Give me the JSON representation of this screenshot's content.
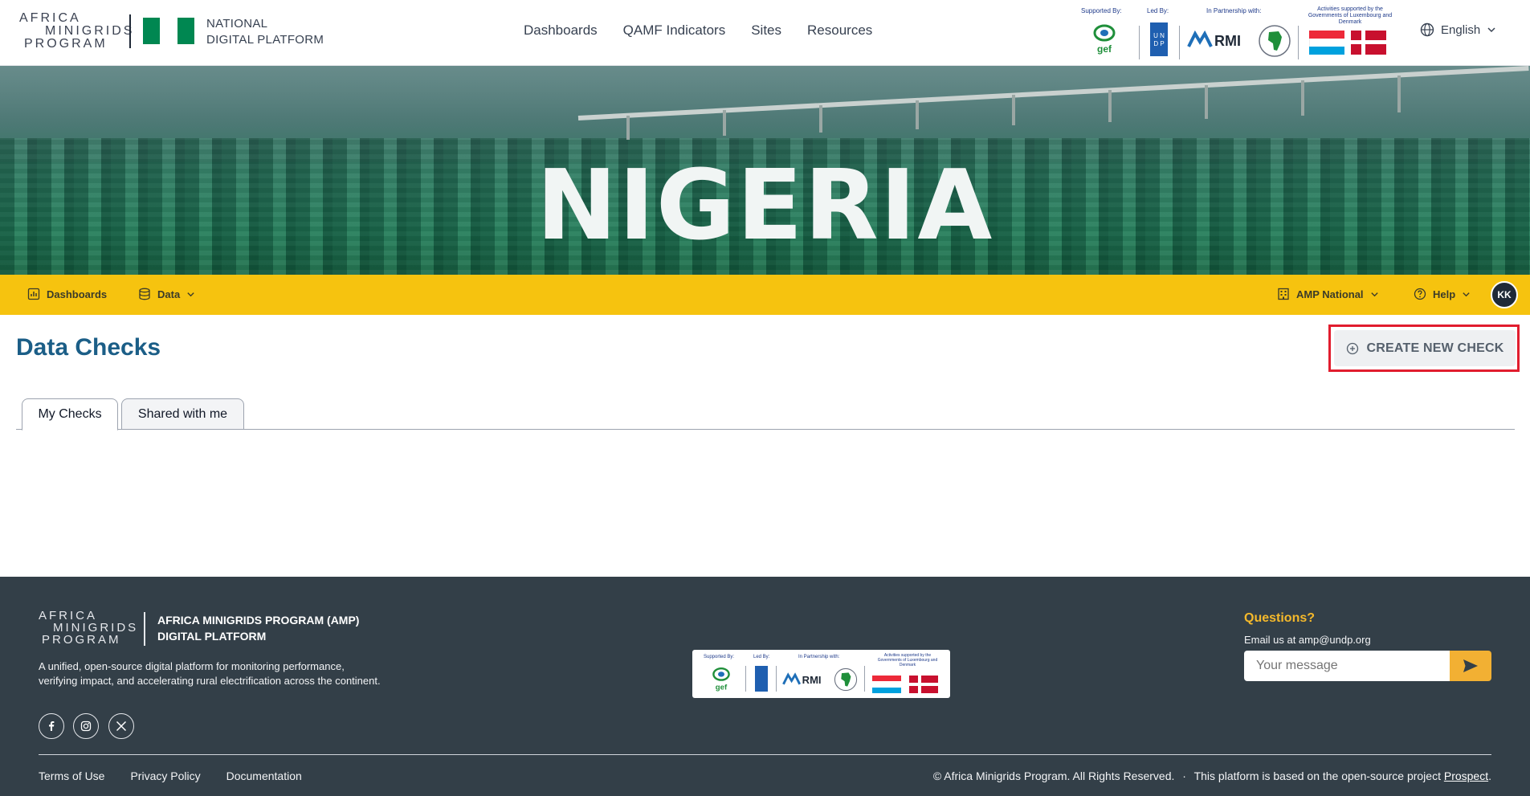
{
  "header": {
    "logo": {
      "line1": "AFRICA",
      "line2": "MINIGRIDS",
      "line3": "PROGRAM"
    },
    "platform_title_line1": "NATIONAL",
    "platform_title_line2": "DIGITAL PLATFORM",
    "flag_colors": [
      "#008751",
      "#ffffff",
      "#008751"
    ],
    "nav": [
      "Dashboards",
      "QAMF Indicators",
      "Sites",
      "Resources"
    ],
    "partners": {
      "supported_by": "Supported By:",
      "led_by": "Led By:",
      "in_partnership": "In Partnership with:",
      "activities": "Activities supported by the Governments of Luxembourg and Denmark",
      "gef": "gef",
      "undp_top": "U N",
      "undp_bottom": "D P",
      "rmi": "RMI"
    },
    "language": "English"
  },
  "hero": {
    "title": "NIGERIA"
  },
  "subnav": {
    "dashboards": "Dashboards",
    "data": "Data",
    "org": "AMP National",
    "help": "Help",
    "avatar_initials": "KK"
  },
  "content": {
    "title": "Data Checks",
    "create_button": "CREATE NEW CHECK",
    "tabs": [
      "My Checks",
      "Shared with me"
    ],
    "active_tab": "My Checks"
  },
  "footer": {
    "logo": {
      "line1": "AFRICA",
      "line2": "MINIGRIDS",
      "line3": "PROGRAM"
    },
    "program_line1": "AFRICA MINIGRIDS PROGRAM (AMP)",
    "program_line2": "DIGITAL PLATFORM",
    "description": "A unified, open-source digital platform for monitoring performance, verifying impact, and accelerating rural electrification across the continent.",
    "social": [
      "facebook-icon",
      "instagram-icon",
      "x-icon"
    ],
    "questions_title": "Questions?",
    "email_text": "Email us at amp@undp.org",
    "message_placeholder": "Your message",
    "links": [
      "Terms of Use",
      "Privacy Policy",
      "Documentation"
    ],
    "copyright": "© Africa Minigrids Program. All Rights Reserved.",
    "separator": "·",
    "based_on": "This platform is based on the open-source project",
    "prospect": "Prospect",
    "period": "."
  },
  "colors": {
    "brand_blue": "#1b5e87",
    "yellow_bar": "#f6c30f",
    "footer_bg": "#333f48",
    "accent_orange": "#f2b033",
    "highlight_red": "#e11d2e"
  }
}
